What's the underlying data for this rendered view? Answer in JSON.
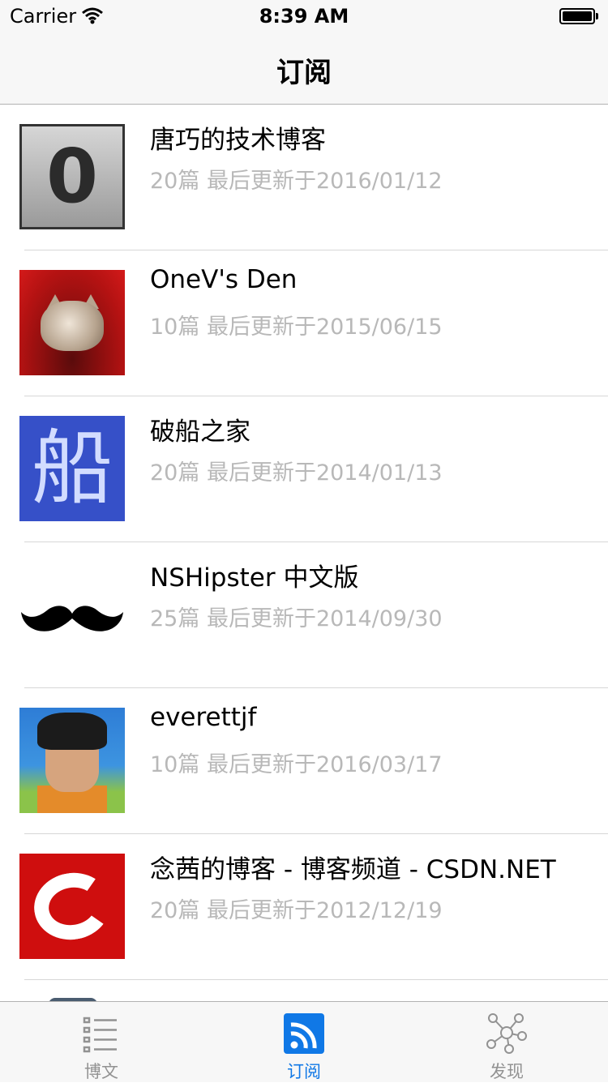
{
  "status_bar": {
    "carrier": "Carrier",
    "time": "8:39 AM"
  },
  "nav": {
    "title": "订阅"
  },
  "feeds": [
    {
      "title": "唐巧的技术博客",
      "subtitle": "20篇 最后更新于2016/01/12",
      "avatar": "zero-logo"
    },
    {
      "title": "OneV's Den",
      "subtitle": "10篇 最后更新于2015/06/15",
      "avatar": "cat-photo"
    },
    {
      "title": "破船之家",
      "subtitle": "20篇 最后更新于2014/01/13",
      "avatar": "ship-character-logo",
      "avatar_text": "船"
    },
    {
      "title": "NSHipster 中文版",
      "subtitle": "25篇 最后更新于2014/09/30",
      "avatar": "mustache-logo"
    },
    {
      "title": "everettjf",
      "subtitle": "10篇 最后更新于2016/03/17",
      "avatar": "pixel-person-avatar"
    },
    {
      "title": "念茜的博客 - 博客频道 - CSDN.NET",
      "subtitle": "20篇 最后更新于2012/12/19",
      "avatar": "csdn-logo"
    }
  ],
  "avatar_glyphs": {
    "zero": "0"
  },
  "tabs": [
    {
      "label": "博文",
      "icon": "list-icon",
      "active": false
    },
    {
      "label": "订阅",
      "icon": "rss-icon",
      "active": true
    },
    {
      "label": "发现",
      "icon": "network-icon",
      "active": false
    }
  ],
  "colors": {
    "accent": "#1078e6",
    "subtitle": "#b8b8b8",
    "bar_bg": "#f7f7f7"
  }
}
